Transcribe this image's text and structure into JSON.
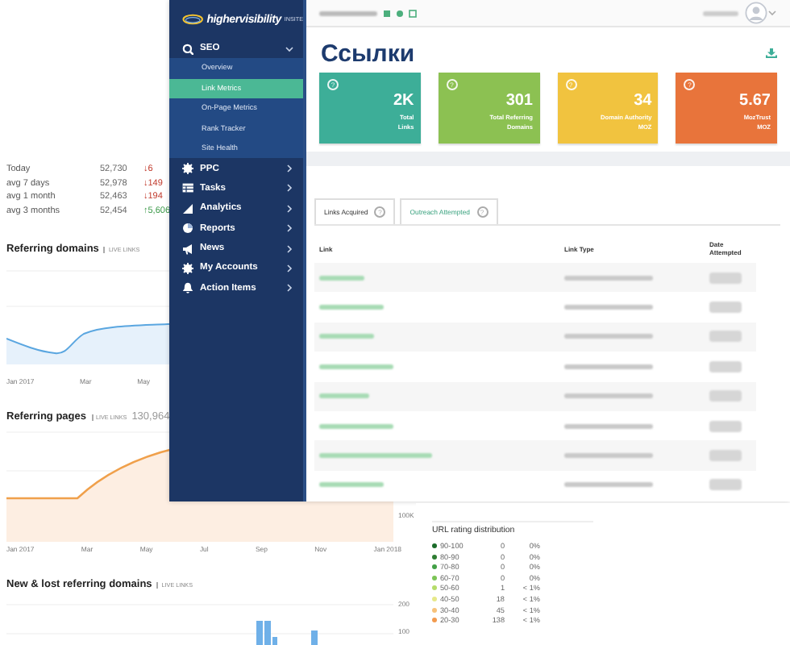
{
  "stats": [
    {
      "label": "Today",
      "value": "52,730",
      "change": "↓6",
      "kind": "down"
    },
    {
      "label": "avg 7 days",
      "value": "52,978",
      "change": "↓149",
      "kind": "down"
    },
    {
      "label": "avg 1 month",
      "value": "52,463",
      "change": "↓194",
      "kind": "down"
    },
    {
      "label": "avg 3 months",
      "value": "52,454",
      "change": "↑5,606",
      "kind": "up"
    }
  ],
  "referring_domains": {
    "title": "Referring domains",
    "badge": "LIVE LINKS",
    "x_labels": [
      "Jan 2017",
      "Mar",
      "May"
    ]
  },
  "referring_pages": {
    "title": "Referring pages",
    "badge": "LIVE LINKS",
    "total": "130,964",
    "tick": "100K",
    "x_labels": [
      "Jan 2017",
      "Mar",
      "May",
      "Jul",
      "Sep",
      "Nov",
      "Jan 2018"
    ]
  },
  "new_lost": {
    "title": "New & lost referring domains",
    "badge": "LIVE LINKS",
    "ticks": [
      "200",
      "100"
    ]
  },
  "url_rating": {
    "title": "URL rating distribution",
    "rows": [
      {
        "range": "90-100",
        "count": "0",
        "share": "0%",
        "color": "#1b6b2a"
      },
      {
        "range": "80-90",
        "count": "0",
        "share": "0%",
        "color": "#2e7d32"
      },
      {
        "range": "70-80",
        "count": "0",
        "share": "0%",
        "color": "#43a047"
      },
      {
        "range": "60-70",
        "count": "0",
        "share": "0%",
        "color": "#7cc456"
      },
      {
        "range": "50-60",
        "count": "1",
        "share": "< 1%",
        "color": "#b5dc6a"
      },
      {
        "range": "40-50",
        "count": "18",
        "share": "< 1%",
        "color": "#e6e88a"
      },
      {
        "range": "30-40",
        "count": "45",
        "share": "< 1%",
        "color": "#f7c27a"
      },
      {
        "range": "20-30",
        "count": "138",
        "share": "< 1%",
        "color": "#f29a4e"
      }
    ]
  },
  "dashboard": {
    "logo": "highervisibility",
    "logo_suffix": "INSITE",
    "menu": [
      {
        "label": "SEO",
        "kind": "search",
        "expanded": true,
        "children": [
          {
            "label": "Overview",
            "selected": false
          },
          {
            "label": "Link Metrics",
            "selected": true
          },
          {
            "label": "On-Page Metrics",
            "selected": false
          },
          {
            "label": "Rank Tracker",
            "selected": false
          },
          {
            "label": "Site Health",
            "selected": false
          }
        ]
      },
      {
        "label": "PPC",
        "kind": "gear",
        "expanded": false
      },
      {
        "label": "Tasks",
        "kind": "table",
        "expanded": false
      },
      {
        "label": "Analytics",
        "kind": "bars",
        "expanded": false
      },
      {
        "label": "Reports",
        "kind": "pie",
        "expanded": false
      },
      {
        "label": "News",
        "kind": "megaphone",
        "expanded": false
      },
      {
        "label": "My Accounts",
        "kind": "gear",
        "expanded": false
      },
      {
        "label": "Action Items",
        "kind": "bell",
        "expanded": false
      }
    ],
    "page_title": "Ссылки",
    "cards": [
      {
        "help": "?",
        "value": "2K",
        "label_lines": [
          "Total",
          "Links"
        ],
        "color": "#3dae98"
      },
      {
        "help": "?",
        "value": "301",
        "label_lines": [
          "Total Referring",
          "Domains"
        ],
        "color": "#8cc152"
      },
      {
        "help": "?",
        "value": "34",
        "label_lines": [
          "Domain Authority",
          "MOZ"
        ],
        "color": "#f1c33f"
      },
      {
        "help": "?",
        "value": "5.67",
        "label_lines": [
          "MozTrust",
          "MOZ"
        ],
        "color": "#e8743b"
      }
    ],
    "tabs": [
      {
        "label": "Links Acquired",
        "help": "?",
        "selected": false
      },
      {
        "label": "Outreach Attempted",
        "help": "?",
        "selected": true
      }
    ],
    "table": {
      "columns": [
        "Link",
        "Link Type",
        "Date Attempted"
      ],
      "rows": [
        {
          "kind": "blurred"
        },
        {
          "kind": "blurred"
        },
        {
          "kind": "blurred"
        },
        {
          "kind": "blurred"
        },
        {
          "kind": "blurred"
        },
        {
          "kind": "blurred"
        },
        {
          "kind": "blurred"
        },
        {
          "kind": "blurred"
        }
      ]
    }
  }
}
